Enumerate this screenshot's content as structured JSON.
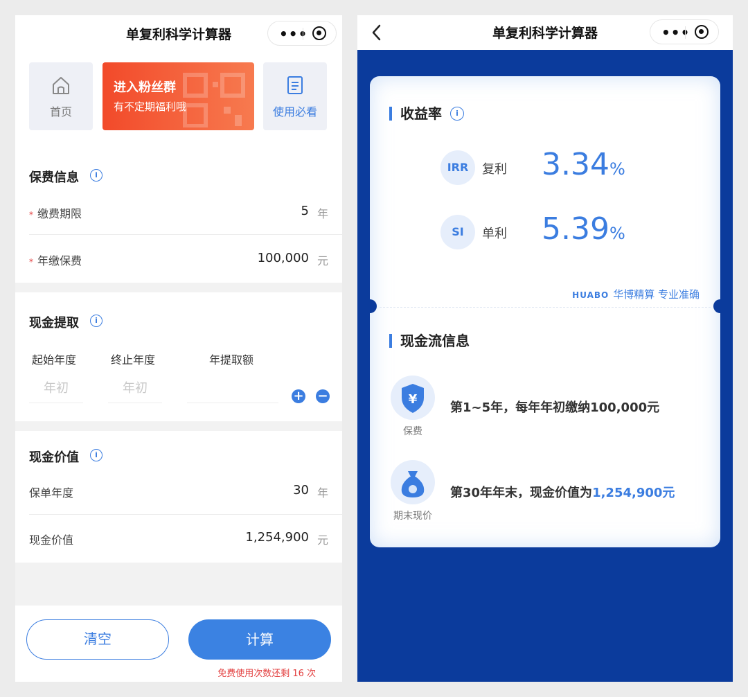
{
  "left": {
    "nav": {
      "title": "单复利科学计算器"
    },
    "tiles": {
      "home": "首页",
      "guide": "使用必看"
    },
    "banner": {
      "line1": "进入粉丝群",
      "line2": "有不定期福利哦"
    },
    "premium": {
      "title": "保费信息",
      "rows": [
        {
          "label": "缴费期限",
          "value": "5",
          "unit": "年"
        },
        {
          "label": "年缴保费",
          "value": "100,000",
          "unit": "元"
        }
      ]
    },
    "withdrawal": {
      "title": "现金提取",
      "columns": [
        "起始年度",
        "终止年度",
        "年提取额"
      ],
      "placeholders": {
        "start": "年初",
        "end": "年初",
        "amount": ""
      }
    },
    "cash_value": {
      "title": "现金价值",
      "rows": [
        {
          "label": "保单年度",
          "value": "30",
          "unit": "年"
        },
        {
          "label": "现金价值",
          "value": "1,254,900",
          "unit": "元"
        }
      ]
    },
    "actions": {
      "clear": "清空",
      "calculate": "计算",
      "remaining": "免费使用次数还剩 16 次"
    }
  },
  "right": {
    "nav": {
      "title": "单复利科学计算器"
    },
    "yield": {
      "title": "收益率",
      "irr": {
        "badge": "IRR",
        "label": "复利",
        "value": "3.34",
        "unit": "%"
      },
      "si": {
        "badge": "SI",
        "label": "单利",
        "value": "5.39",
        "unit": "%"
      }
    },
    "brand": {
      "mark": "HUABO",
      "text": "华博精算  专业准确"
    },
    "cashflow": {
      "title": "现金流信息",
      "premium_caption": "保费",
      "premium_text": "第1~5年，每年年初缴纳100,000元",
      "end_caption": "期末现价",
      "end_text_prefix": "第30年年末，现金价值为",
      "end_text_value": "1,254,900元"
    }
  },
  "colors": {
    "accent": "#3b7de0",
    "background_blue": "#0b3b9c",
    "banner_red": "#f24a2a",
    "required_red": "#e34040"
  }
}
